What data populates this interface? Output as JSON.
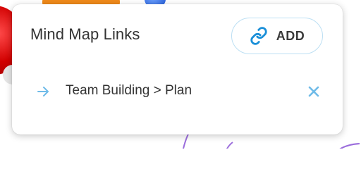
{
  "panel": {
    "title": "Mind Map Links",
    "add_button": {
      "label": "ADD",
      "icon": "link-icon"
    },
    "links": [
      {
        "label": "Team Building > Plan",
        "leading_icon": "arrow-right-icon",
        "trailing_icon": "close-icon"
      }
    ]
  },
  "colors": {
    "accent": "#1a8fd8",
    "accent_light": "#6fbbe8",
    "button_border": "#bcdff3",
    "text": "#333333"
  }
}
